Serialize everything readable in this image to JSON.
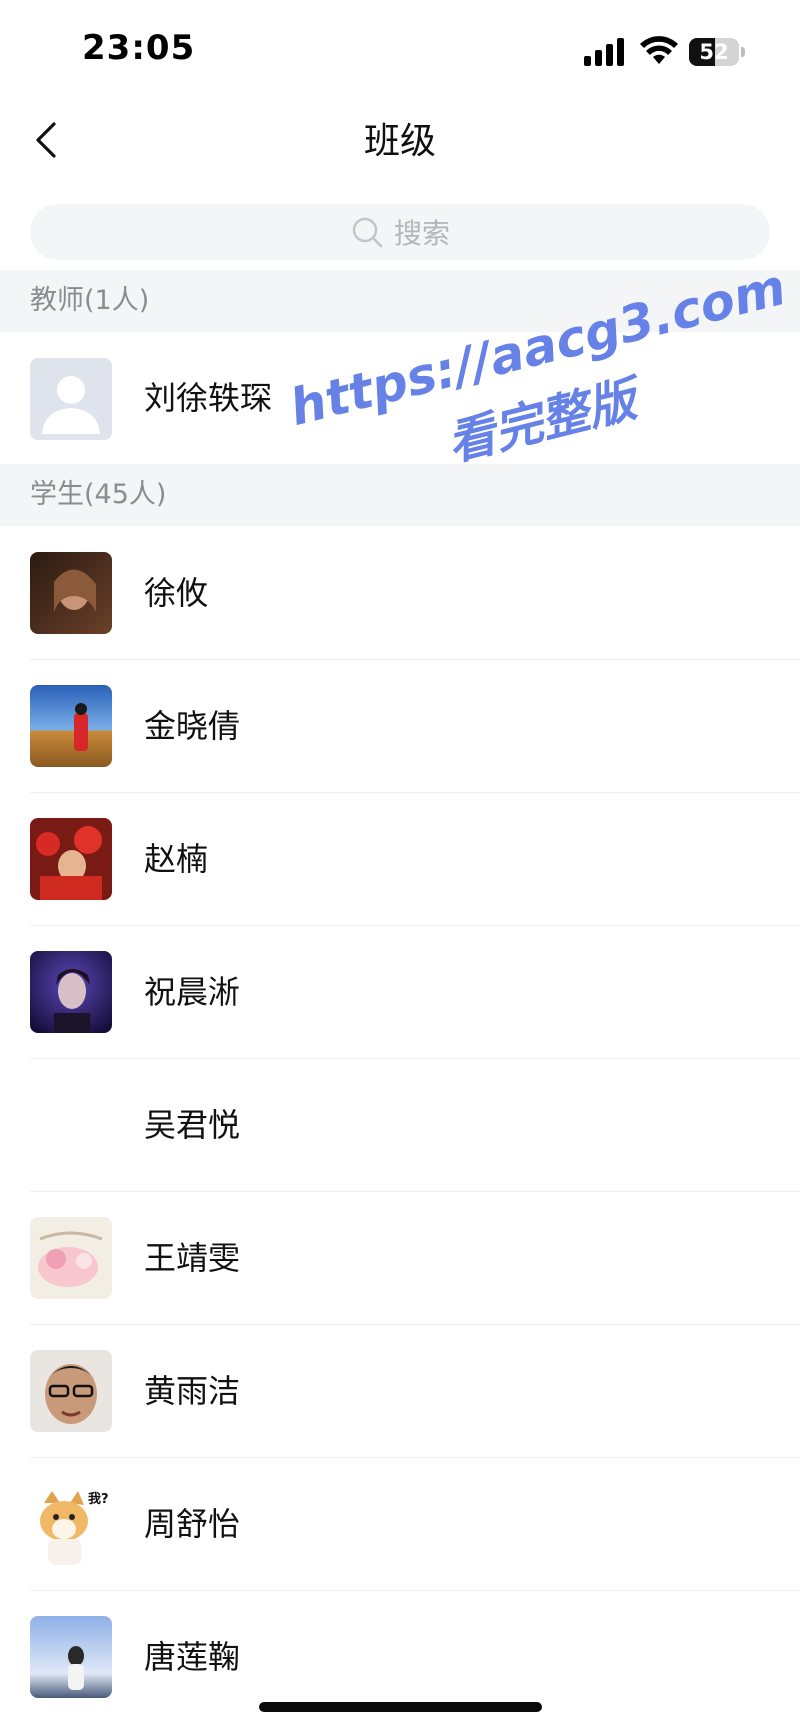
{
  "status_bar": {
    "time": "23:05",
    "battery": "52",
    "battery_level": 0.52,
    "icons": [
      "cellular-signal-icon",
      "wifi-icon",
      "battery-icon"
    ]
  },
  "nav": {
    "title": "班级",
    "back_icon": "chevron-left-icon"
  },
  "search": {
    "placeholder": "搜索",
    "icon": "search-icon"
  },
  "teachers": {
    "header": "教师(1人)",
    "items": [
      {
        "name": "刘徐轶琛",
        "avatar": "default-person-avatar"
      }
    ]
  },
  "students": {
    "header": "学生(45人)",
    "items": [
      {
        "name": "徐攸",
        "avatar": "photo-avatar"
      },
      {
        "name": "金晓倩",
        "avatar": "photo-avatar"
      },
      {
        "name": "赵楠",
        "avatar": "photo-avatar"
      },
      {
        "name": "祝晨淅",
        "avatar": "photo-avatar"
      },
      {
        "name": "吴君悦",
        "avatar": "none"
      },
      {
        "name": "王靖雯",
        "avatar": "cartoon-avatar"
      },
      {
        "name": "黄雨洁",
        "avatar": "photo-avatar"
      },
      {
        "name": "周舒怡",
        "avatar": "cat-sticker-avatar",
        "avatar_text": "我?"
      },
      {
        "name": "唐莲鞠",
        "avatar": "photo-avatar"
      }
    ]
  },
  "watermark": {
    "line1": "https://aacg3.com",
    "line2": "看完整版"
  },
  "colors": {
    "background": "#ffffff",
    "section_bg": "#f4f5f7",
    "section_text": "#8a8c91",
    "search_bg": "#f4f5f7",
    "placeholder": "#b4b6bb",
    "watermark": "#5a78e6"
  }
}
